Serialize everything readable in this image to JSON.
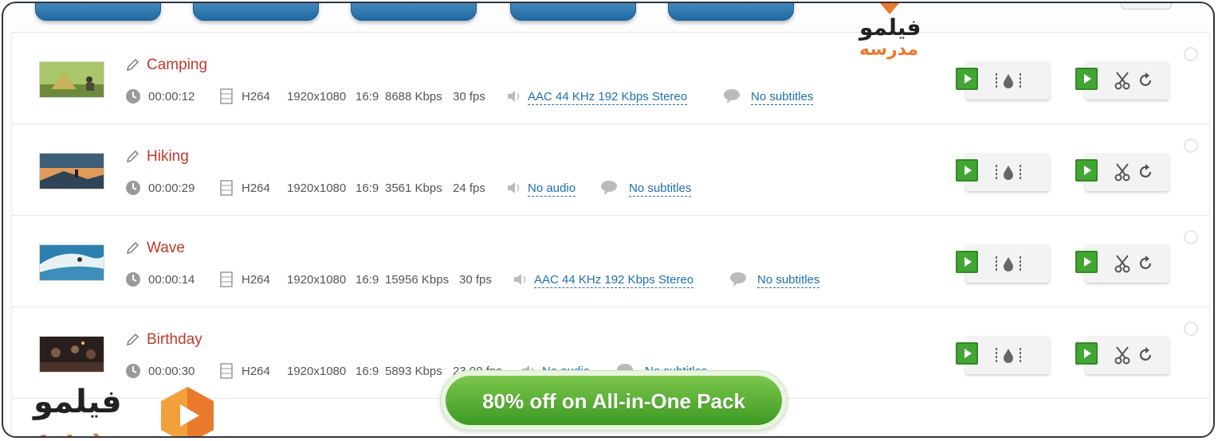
{
  "videos": [
    {
      "title": "Camping",
      "duration": "00:00:12",
      "codec": "H264",
      "resolution": "1920x1080",
      "aspect": "16:9",
      "bitrate": "8688 Kbps",
      "fps": "30 fps",
      "audio": "AAC  44 KHz  192 Kbps  Stereo",
      "subtitles": "No subtitles"
    },
    {
      "title": "Hiking",
      "duration": "00:00:29",
      "codec": "H264",
      "resolution": "1920x1080",
      "aspect": "16:9",
      "bitrate": "3561 Kbps",
      "fps": "24 fps",
      "audio": "No audio",
      "subtitles": "No subtitles"
    },
    {
      "title": "Wave",
      "duration": "00:00:14",
      "codec": "H264",
      "resolution": "1920x1080",
      "aspect": "16:9",
      "bitrate": "15956 Kbps",
      "fps": "30 fps",
      "audio": "AAC  44 KHz  192 Kbps  Stereo",
      "subtitles": "No subtitles"
    },
    {
      "title": "Birthday",
      "duration": "00:00:30",
      "codec": "H264",
      "resolution": "1920x1080",
      "aspect": "16:9",
      "bitrate": "5893 Kbps",
      "fps": "23.98 fps",
      "audio": "No audio",
      "subtitles": "No subtitles"
    }
  ],
  "promo": {
    "label": "80% off on All-in-One Pack"
  },
  "watermark": {
    "line1": "فیلمو",
    "line2": "مدرسه"
  },
  "colors": {
    "title_red": "#c0392b",
    "link_blue": "#1e6fb0",
    "promo_green": "#4fa82e",
    "play_green": "#43a534",
    "brand_orange": "#e9792b"
  },
  "icons": [
    "edit-icon",
    "clock-icon",
    "film-icon",
    "speaker-icon",
    "speech-bubble-icon",
    "play-icon",
    "watermark-effect-icon",
    "scissors-icon",
    "rotate-icon"
  ]
}
